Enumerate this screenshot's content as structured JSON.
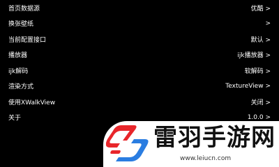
{
  "settings": {
    "items": [
      {
        "label": "首页数据源",
        "value": "优酷 >"
      },
      {
        "label": "换张壁纸",
        "value": ">"
      },
      {
        "label": "当前配置接口",
        "value": "默认 >"
      },
      {
        "label": "播放器",
        "value": "ijk播放器 >"
      },
      {
        "label": "ijk解码",
        "value": "软解码 >"
      },
      {
        "label": "渲染方式",
        "value": "TextureView >"
      },
      {
        "label": "使用XWalkView",
        "value": "关闭 >"
      },
      {
        "label": "关于",
        "value": "1.0.0 >"
      }
    ]
  },
  "watermark": {
    "name": "雷羽手游网",
    "url": "www.leiucn.com"
  },
  "colors": {
    "background": "#000000",
    "text": "#ffffff",
    "logo_red": "#e8262b",
    "logo_blue": "#2a7de1"
  }
}
